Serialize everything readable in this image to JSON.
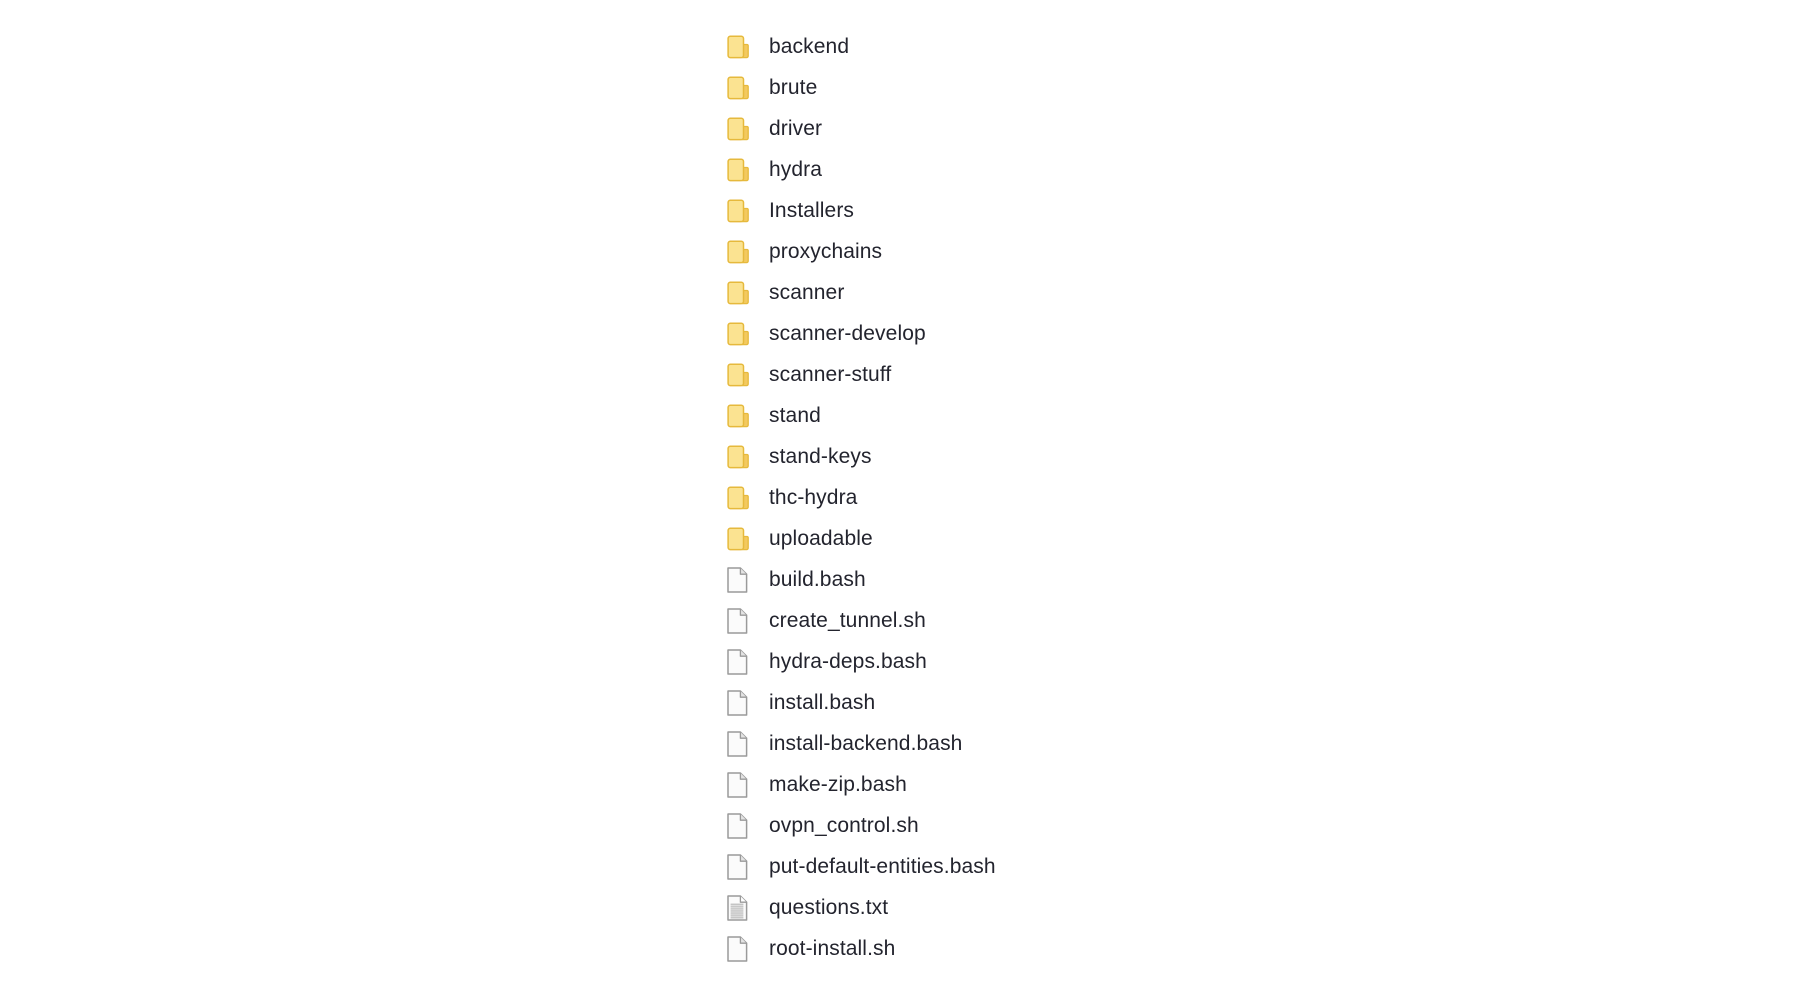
{
  "view": {
    "background_color": "#ffffff",
    "text_color": "#23242e"
  },
  "icons": {
    "folder": {
      "name": "folder-icon",
      "fill_color": "#FBE391",
      "border_color": "#E6B93C",
      "tab_color": "#F3C95F"
    },
    "file": {
      "name": "file-icon",
      "fill_color": "#FBFBFB",
      "border_color": "#9A9A9A",
      "fold_color": "#E4E4E4"
    },
    "text_file": {
      "name": "text-file-icon",
      "fill_color": "#FBFBFB",
      "border_color": "#9A9A9A",
      "line_color": "#AEAEAE"
    }
  },
  "file_listing": {
    "entries": [
      {
        "name": "backend",
        "type": "folder"
      },
      {
        "name": "brute",
        "type": "folder"
      },
      {
        "name": "driver",
        "type": "folder"
      },
      {
        "name": "hydra",
        "type": "folder"
      },
      {
        "name": "Installers",
        "type": "folder"
      },
      {
        "name": "proxychains",
        "type": "folder"
      },
      {
        "name": "scanner",
        "type": "folder"
      },
      {
        "name": "scanner-develop",
        "type": "folder"
      },
      {
        "name": "scanner-stuff",
        "type": "folder"
      },
      {
        "name": "stand",
        "type": "folder"
      },
      {
        "name": "stand-keys",
        "type": "folder"
      },
      {
        "name": "thc-hydra",
        "type": "folder"
      },
      {
        "name": "uploadable",
        "type": "folder"
      },
      {
        "name": "build.bash",
        "type": "file"
      },
      {
        "name": "create_tunnel.sh",
        "type": "file"
      },
      {
        "name": "hydra-deps.bash",
        "type": "file"
      },
      {
        "name": "install.bash",
        "type": "file"
      },
      {
        "name": "install-backend.bash",
        "type": "file"
      },
      {
        "name": "make-zip.bash",
        "type": "file"
      },
      {
        "name": "ovpn_control.sh",
        "type": "file"
      },
      {
        "name": "put-default-entities.bash",
        "type": "file"
      },
      {
        "name": "questions.txt",
        "type": "text_file"
      },
      {
        "name": "root-install.sh",
        "type": "file"
      }
    ]
  }
}
